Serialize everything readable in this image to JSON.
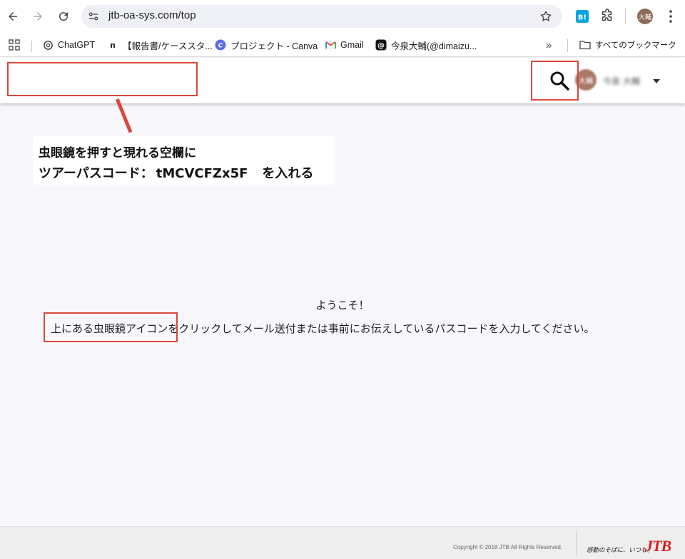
{
  "browser": {
    "url": "jtb-oa-sys.com/top",
    "profile_initials": "大輔",
    "bookmarks": [
      {
        "label": "ChatGPT",
        "icon": "chatgpt-icon"
      },
      {
        "label": "【報告書/ケーススタ...",
        "icon": "note-icon"
      },
      {
        "label": "プロジェクト - Canva",
        "icon": "canva-icon"
      },
      {
        "label": "Gmail",
        "icon": "gmail-icon"
      },
      {
        "label": "今泉大輔(@dimaizu...",
        "icon": "threads-icon"
      }
    ],
    "all_bookmarks_label": "すべてのブックマーク"
  },
  "header": {
    "avatar_initials": "大輔",
    "username": "今泉 大輔"
  },
  "annotation": {
    "line1": "虫眼鏡を押すと現れる空欄に",
    "line2_prefix": "ツアーパスコード：",
    "passcode": "tMCVCFZx5F",
    "line2_suffix": "を入れる"
  },
  "main": {
    "welcome": "ようこそ！",
    "instruction": "上にある虫眼鏡アイコンをクリックしてメール送付または事前にお伝えしているパスコードを入力してください。"
  },
  "footer": {
    "copyright": "Copyright © 2018 JTB All Rights Reserved.",
    "slogan": "感動のそばに、いつも。",
    "logo": "JTB"
  },
  "colors": {
    "annotation_red": "#d9483b",
    "logo_red": "#d71e1e"
  }
}
